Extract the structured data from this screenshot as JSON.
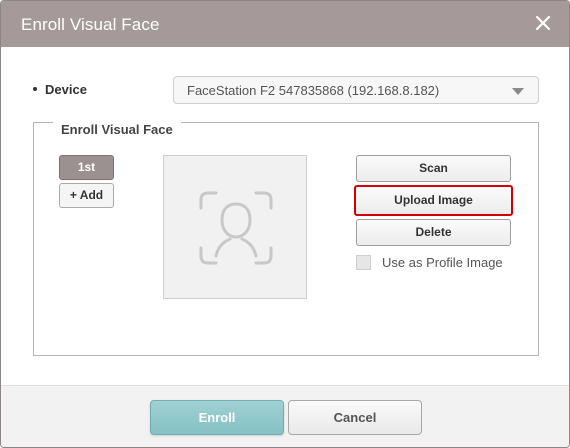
{
  "dialog": {
    "title": "Enroll Visual Face",
    "close_icon": "close-icon"
  },
  "device": {
    "label": "Device",
    "selected": "FaceStation F2 547835868 (192.168.8.182)"
  },
  "enroll_group": {
    "legend": "Enroll Visual Face",
    "tabs": [
      {
        "label": "1st",
        "active": true
      }
    ],
    "add_label": "+ Add",
    "face_placeholder_icon": "face-scan-icon",
    "buttons": {
      "scan": "Scan",
      "upload": "Upload Image",
      "delete": "Delete"
    },
    "profile_checkbox": {
      "label": "Use as Profile Image",
      "checked": false
    }
  },
  "footer": {
    "enroll": "Enroll",
    "cancel": "Cancel"
  },
  "colors": {
    "titlebar": "#a59a99",
    "active_tab": "#9c9191",
    "highlight_border": "#d40000",
    "primary_button": "#8cc4c7"
  }
}
